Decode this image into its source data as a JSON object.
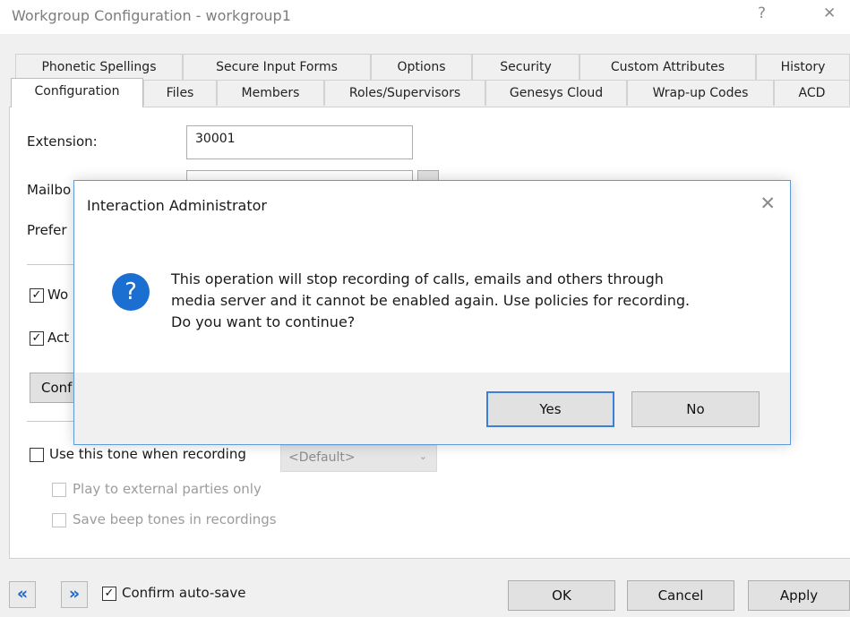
{
  "window": {
    "title": "Workgroup Configuration - workgroup1",
    "help_glyph": "?",
    "close_glyph": "✕"
  },
  "tabs": {
    "row1": [
      "Phonetic Spellings",
      "Secure Input Forms",
      "Options",
      "Security",
      "Custom Attributes",
      "History"
    ],
    "row2": [
      "Configuration",
      "Files",
      "Members",
      "Roles/Supervisors",
      "Genesys Cloud",
      "Wrap-up Codes",
      "ACD"
    ],
    "active": "Configuration"
  },
  "form": {
    "extension_label": "Extension:",
    "extension_value": "30001",
    "mailbox_label": "Mailbo",
    "preferred_label": "Prefer",
    "workgroup_check_label": "Wo",
    "workgroup_checked": true,
    "active_check_label": "Act",
    "active_checked": true,
    "conf_button_label": "Conf",
    "tone_label": "Use this tone when recording",
    "tone_checked": false,
    "tone_select_value": "<Default>",
    "play_external_label": "Play to external parties only",
    "save_beep_label": "Save beep tones in recordings"
  },
  "footer": {
    "confirm_autosave_label": "Confirm auto-save",
    "confirm_autosave_checked": true,
    "ok_label": "OK",
    "cancel_label": "Cancel",
    "apply_label": "Apply",
    "prev_glyph": "«",
    "next_glyph": "»"
  },
  "dialog": {
    "title": "Interaction Administrator",
    "close_glyph": "✕",
    "icon_glyph": "?",
    "message_lines": [
      "This operation will stop recording of calls, emails and others through",
      "media server and it cannot be enabled again. Use policies for recording.",
      "Do you want to continue?"
    ],
    "yes_label": "Yes",
    "no_label": "No"
  },
  "colors": {
    "accent": "#1a6fd0",
    "dialog_border": "#5f9ad6",
    "default_button_border": "#3c7fd6"
  },
  "check_glyph": "✓"
}
